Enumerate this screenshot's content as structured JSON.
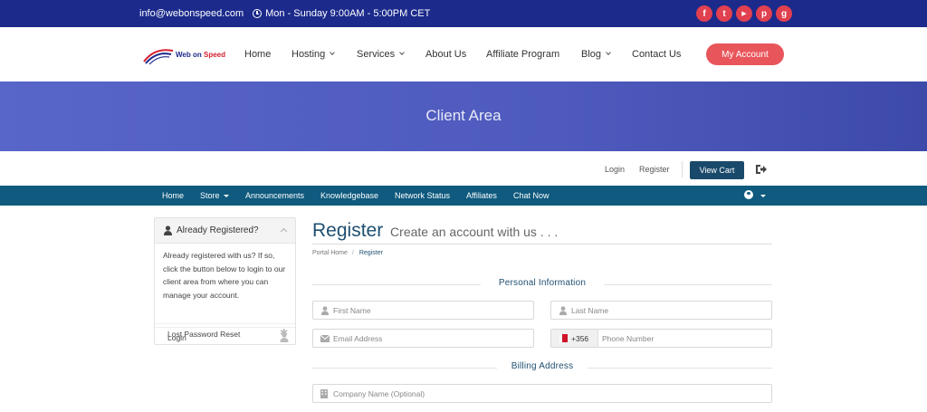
{
  "topbar": {
    "email": "info@webonspeed.com",
    "hours": "Mon - Sunday 9:00AM - 5:00PM CET",
    "social": [
      {
        "icon": "facebook-icon",
        "glyph": "f"
      },
      {
        "icon": "twitter-icon",
        "glyph": "t"
      },
      {
        "icon": "youtube-icon",
        "glyph": "▶"
      },
      {
        "icon": "pinterest-icon",
        "glyph": "p"
      },
      {
        "icon": "github-icon",
        "glyph": "g"
      }
    ]
  },
  "header": {
    "logo_text_a": "Web on",
    "logo_text_b": "Speed",
    "nav": [
      "Home",
      "Hosting",
      "Services",
      "About Us",
      "Affiliate Program",
      "Blog",
      "Contact Us"
    ],
    "my_account": "My Account"
  },
  "banner": {
    "title": "Client Area"
  },
  "utility": {
    "login": "Login",
    "register": "Register",
    "view_cart": "View Cart"
  },
  "subnav": [
    "Home",
    "Store",
    "Announcements",
    "Knowledgebase",
    "Network Status",
    "Affiliates",
    "Chat Now"
  ],
  "sidebar": {
    "title": "Already Registered?",
    "body": "Already registered with us? If so, click the button below to login to our client area from where you can manage your account.",
    "items": [
      {
        "label": "Login",
        "icon": "user-icon"
      },
      {
        "label": "Lost Password Reset",
        "icon": "asterisk-icon"
      }
    ]
  },
  "register": {
    "title": "Register",
    "subtitle": "Create an account with us . . .",
    "breadcrumb": [
      "Portal Home",
      "Register"
    ],
    "sections": {
      "personal": "Personal Information",
      "billing": "Billing Address"
    },
    "fields": {
      "first_name": "First Name",
      "last_name": "Last Name",
      "email": "Email Address",
      "phone_code": "+356",
      "phone": "Phone Number",
      "company": "Company Name (Optional)"
    }
  },
  "colors": {
    "topbar": "#1b2a8b",
    "accent_red": "#e8565b",
    "banner": "#5260c3",
    "subnav": "#0f5a7e",
    "heading": "#1f4f70"
  }
}
